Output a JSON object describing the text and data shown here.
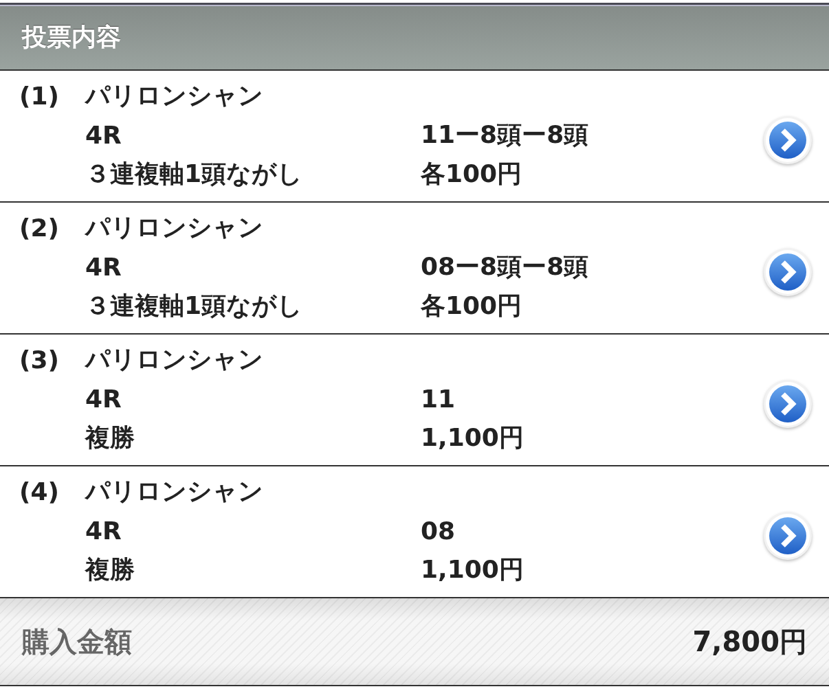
{
  "header": {
    "title": "投票内容"
  },
  "bets": [
    {
      "index": "(1)",
      "venue": "パリロンシャン",
      "race": "4R",
      "selection": "11ー8頭ー8頭",
      "bet_type": "３連複軸1頭ながし",
      "amount": "各100円"
    },
    {
      "index": "(2)",
      "venue": "パリロンシャン",
      "race": "4R",
      "selection": "08ー8頭ー8頭",
      "bet_type": "３連複軸1頭ながし",
      "amount": "各100円"
    },
    {
      "index": "(3)",
      "venue": "パリロンシャン",
      "race": "4R",
      "selection": "11",
      "bet_type": "複勝",
      "amount": "1,100円"
    },
    {
      "index": "(4)",
      "venue": "パリロンシャン",
      "race": "4R",
      "selection": "08",
      "bet_type": "複勝",
      "amount": "1,100円"
    }
  ],
  "total": {
    "label": "購入金額",
    "value": "7,800円"
  }
}
